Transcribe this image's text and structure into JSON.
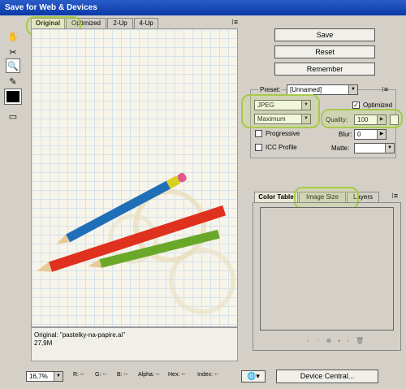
{
  "window": {
    "title": "Save for Web & Devices"
  },
  "tabs": [
    {
      "label": "Original"
    },
    {
      "label": "Optimized"
    },
    {
      "label": "2-Up"
    },
    {
      "label": "4-Up"
    }
  ],
  "buttons": {
    "save": "Save",
    "reset": "Reset",
    "remember": "Remember",
    "device_central": "Device Central..."
  },
  "preset": {
    "label": "Preset:",
    "value": "[Unnamed]"
  },
  "format": {
    "value": "JPEG"
  },
  "compression": {
    "value": "Maximum"
  },
  "optimized": {
    "label": "Optimized",
    "checked": true
  },
  "quality": {
    "label": "Quality:",
    "value": "100"
  },
  "progressive": {
    "label": "Progressive"
  },
  "blur": {
    "label": "Blur:",
    "value": "0"
  },
  "icc": {
    "label": "ICC Profile"
  },
  "matte": {
    "label": "Matte:"
  },
  "panel_tabs": [
    {
      "label": "Color Table"
    },
    {
      "label": "Image Size"
    },
    {
      "label": "Layers"
    }
  ],
  "image_info": {
    "name": "Original: \"pastelky-na-papire.ai\"",
    "size": "27,9M"
  },
  "statusbar": {
    "zoom": "16,7%",
    "r": "R: --",
    "g": "G: --",
    "b": "B: --",
    "alpha": "Alpha: --",
    "hex": "Hex: --",
    "index": "Index: --"
  },
  "colors": {
    "title_bar": "#0a3aa8",
    "highlight": "#a7c94a",
    "pencil_blue": "#1f6fb8",
    "pencil_red": "#e0301e",
    "pencil_green": "#6aa82a"
  }
}
